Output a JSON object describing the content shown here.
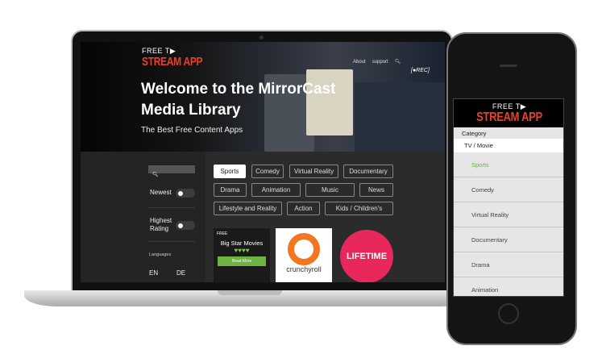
{
  "logo": {
    "line1": "FREE T▶",
    "line2": "STREAM APP"
  },
  "nav": {
    "about": "About",
    "support": "support"
  },
  "badge": "[●REC]",
  "hero": {
    "title": "Welcome to the MirrorCast Media Library",
    "subtitle": "The Best Free Content Apps"
  },
  "sidebar": {
    "newest": "Newest",
    "highest_rating": "Highest Rating",
    "languages": "Languages",
    "lang_en": "EN",
    "lang_de": "DE"
  },
  "chips": [
    "Sports",
    "Comedy",
    "Virtual Reality",
    "Documentary",
    "Drama",
    "Animation",
    "Music",
    "News",
    "Lifestyle and Reality",
    "Action",
    "Kids / Children's"
  ],
  "cards": [
    {
      "tag": "FREE",
      "title": "Big Star Movies",
      "hearts": "♥♥♥♥",
      "button": "Read More"
    },
    {
      "title": "crunchyroll"
    },
    {
      "title": "LIFETIME"
    }
  ],
  "phone": {
    "category": "Category",
    "section": "TV / Movie",
    "items": [
      "Sports",
      "Comedy",
      "Virtual Reality",
      "Documentary",
      "Drama",
      "Animation"
    ]
  },
  "colors": {
    "accent_green": "#6db33f",
    "logo_red": "#e8402a",
    "lifetime": "#e8285a",
    "crunchyroll": "#f47521"
  }
}
